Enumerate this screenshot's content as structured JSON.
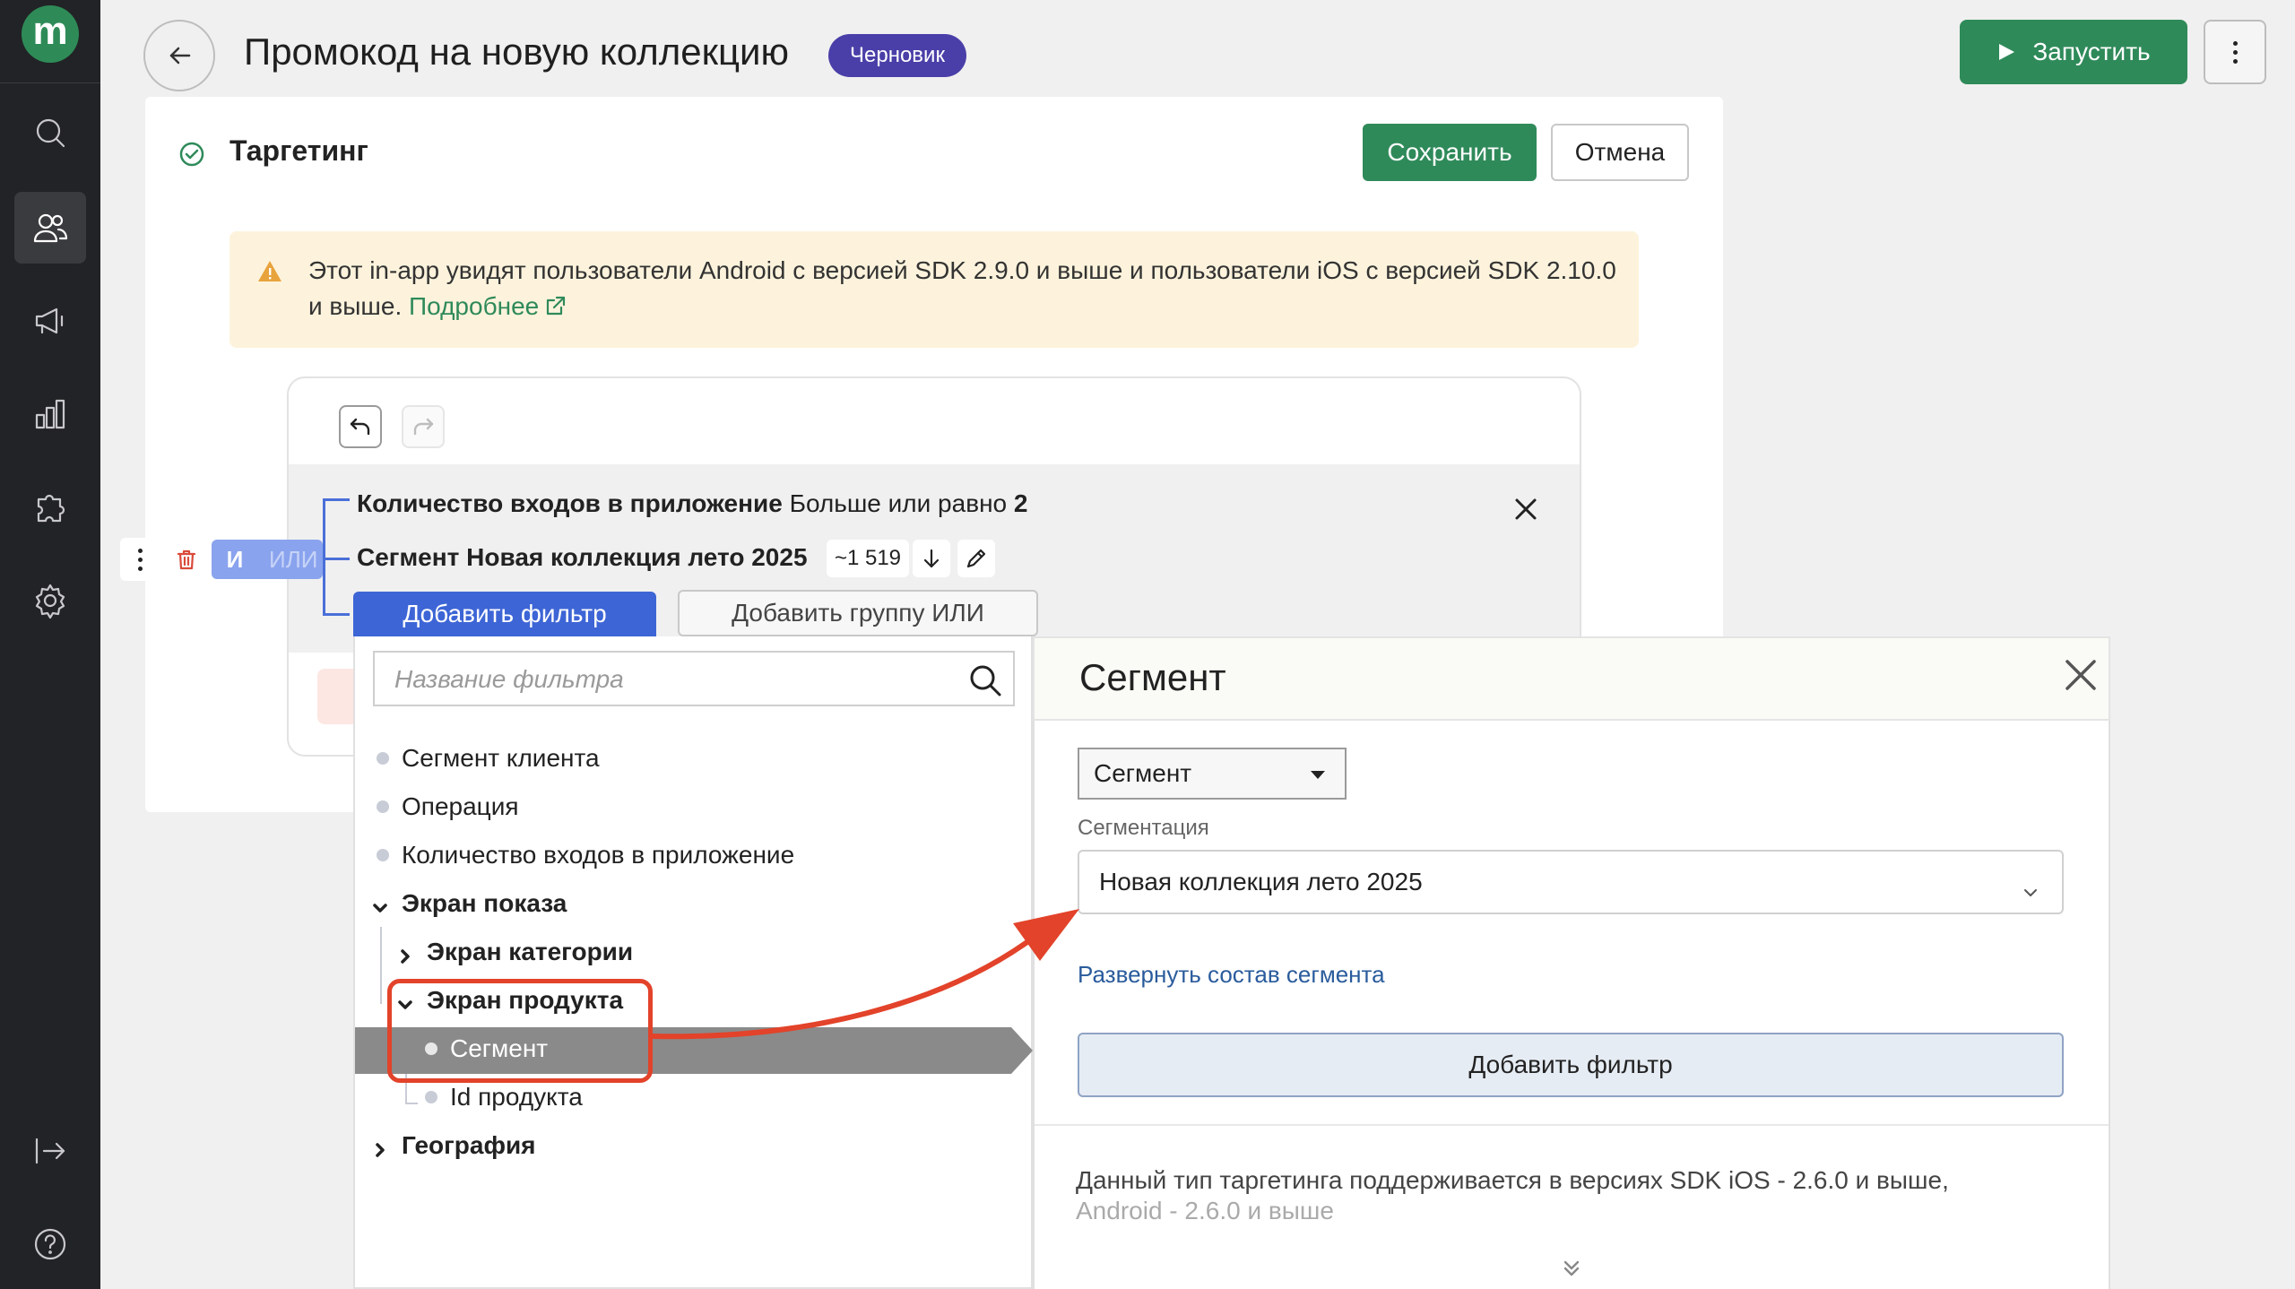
{
  "header": {
    "title": "Промокод на новую коллекцию",
    "status_badge": "Черновик",
    "run_label": "Запустить"
  },
  "sidebar": {
    "logo": "m",
    "items": [
      {
        "icon": "search-icon"
      },
      {
        "icon": "users-icon",
        "active": true
      },
      {
        "icon": "megaphone-icon"
      },
      {
        "icon": "analytics-icon"
      },
      {
        "icon": "puzzle-icon"
      },
      {
        "icon": "settings-icon"
      },
      {
        "icon": "logout-icon"
      },
      {
        "icon": "help-icon"
      }
    ]
  },
  "section": {
    "title": "Таргетинг",
    "save_label": "Сохранить",
    "cancel_label": "Отмена"
  },
  "warning": {
    "text": "Этот in-app увидят пользователи Android с версией SDK 2.9.0 и выше и пользователи iOS с версией SDK 2.10.0 и выше.",
    "link": "Подробнее"
  },
  "conditions": {
    "row1_name": "Количество входов в приложение",
    "row1_op": "Больше или равно",
    "row1_value": "2",
    "row2_name": "Сегмент Новая коллекция лето 2025",
    "row2_count": "~1 519",
    "and_label": "И",
    "or_label": "ИЛИ",
    "add_filter": "Добавить фильтр",
    "add_or_group": "Добавить группу ИЛИ"
  },
  "filter_list": {
    "search_placeholder": "Название фильтра",
    "items": [
      "Сегмент клиента",
      "Операция",
      "Количество входов в приложение",
      "Экран показа",
      "Экран категории",
      "Экран продукта",
      "Сегмент",
      "Id продукта",
      "География"
    ]
  },
  "segment_panel": {
    "title": "Сегмент",
    "type_select": "Сегмент",
    "segmentation_label": "Сегментация",
    "segmentation_value": "Новая коллекция лето 2025",
    "expand_link": "Развернуть состав сегмента",
    "add_filter": "Добавить фильтр",
    "note_line1": "Данный тип таргетинга поддерживается в версиях SDK iOS - 2.6.0 и выше,",
    "note_line2": "Android - 2.6.0 и выше"
  },
  "colors": {
    "brand_green": "#2f8a5a",
    "badge_purple": "#4a3fa8",
    "primary_blue": "#3d65d6",
    "annotation_red": "#e2432a"
  }
}
